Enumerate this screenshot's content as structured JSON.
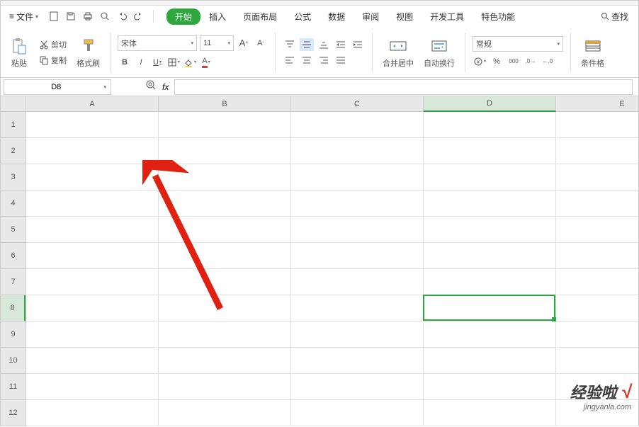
{
  "menu": {
    "file": "文件",
    "tabs": [
      "开始",
      "插入",
      "页面布局",
      "公式",
      "数据",
      "审阅",
      "视图",
      "开发工具",
      "特色功能"
    ],
    "find": "查找"
  },
  "ribbon": {
    "paste": "粘贴",
    "cut": "剪切",
    "copy": "复制",
    "format_painter": "格式刷",
    "font_name": "宋体",
    "font_size": "11",
    "bold": "B",
    "italic": "I",
    "underline": "U",
    "merge_center": "合并居中",
    "wrap_text": "自动换行",
    "number_format": "常规",
    "cond_fmt": "条件格"
  },
  "namebox": {
    "cell_ref": "D8"
  },
  "columns": [
    "A",
    "B",
    "C",
    "D",
    "E"
  ],
  "rows": [
    "1",
    "2",
    "3",
    "4",
    "5",
    "6",
    "7",
    "8",
    "9",
    "10",
    "11",
    "12"
  ],
  "active": {
    "col_index": 3,
    "row_index": 7
  },
  "watermark": {
    "main": "经验啦",
    "check": "√",
    "sub": "jingyanla.com"
  }
}
